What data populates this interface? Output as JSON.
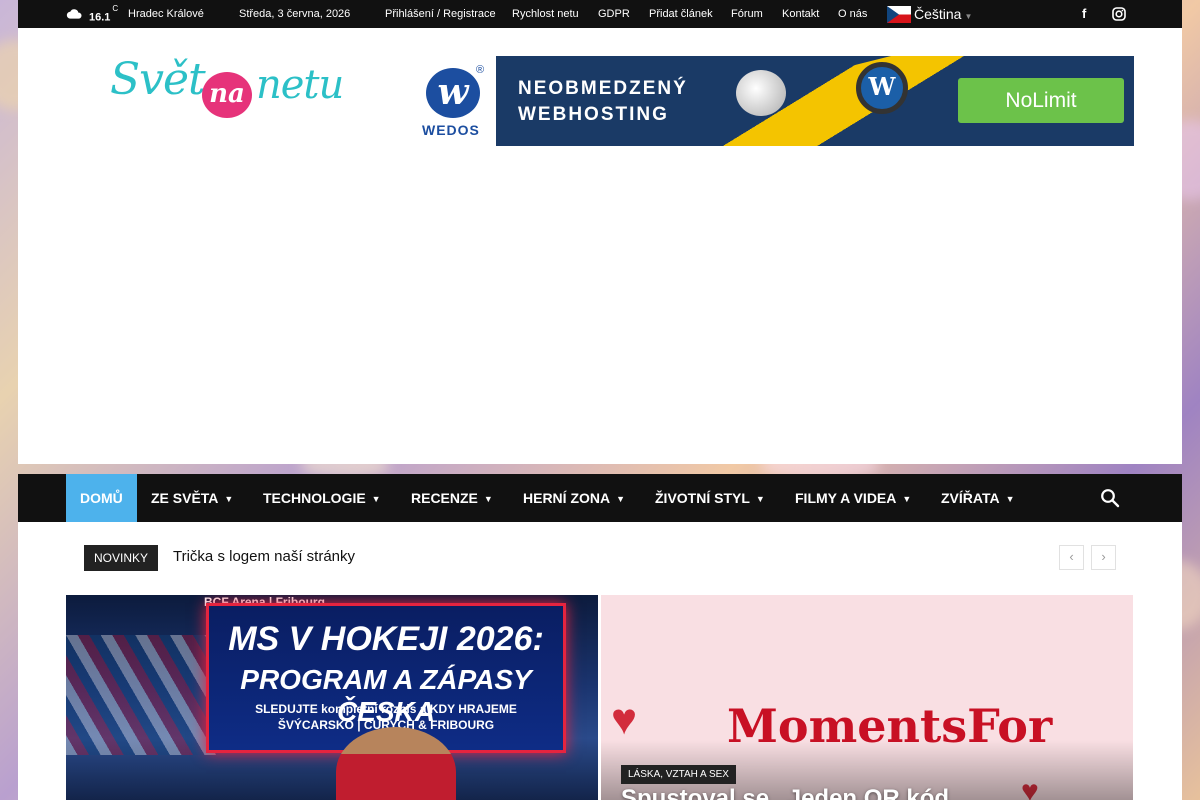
{
  "topbar": {
    "temperature": "16.1",
    "unit": "C",
    "city": "Hradec Králové",
    "date": "Středa, 3 června, 2026",
    "links": [
      "Přihlášení / Registrace",
      "Rychlost netu",
      "GDPR",
      "Přidat článek",
      "Fórum",
      "Kontakt",
      "O nás"
    ],
    "language": "Čeština",
    "icons": [
      "cloud-icon",
      "czech-flag-icon",
      "facebook-icon",
      "instagram-icon"
    ]
  },
  "logo": {
    "part1": "Svět",
    "part2": "na",
    "part3": "netu"
  },
  "banner": {
    "brand": "WEDOS",
    "reg": "®",
    "line1": "NEOBMEDZENÝ",
    "line2": "WEBHOSTING",
    "cta": "NoLimit",
    "accent": "#6cc24a"
  },
  "nav": {
    "items": [
      "DOMŮ",
      "ZE SVĚTA",
      "TECHNOLOGIE",
      "RECENZE",
      "HERNÍ ZONA",
      "ŽIVOTNÍ STYL",
      "FILMY A VIDEA",
      "ZVÍŘATA"
    ],
    "active_color": "#4db2ec"
  },
  "ticker": {
    "label": "NOVINKY",
    "text": "Trička s logem naší stránky",
    "prev": "‹",
    "next": "›"
  },
  "featured": [
    {
      "arena": "BCF Arena | Fribourg",
      "line1": "MS V HOKEJI 2026:",
      "line2": "PROGRAM A ZÁPASY ČESKA",
      "line3": "SLEDUJTE kompletní rozpis a KDY HRAJEME",
      "line4": "ŠVÝCARSKO | CURYCH & FRIBOURG"
    },
    {
      "image_text": "MomentsFor",
      "category": "LÁSKA, VZTAH A SEX",
      "title": "Spustoval se „Jeden QR kód"
    }
  ]
}
